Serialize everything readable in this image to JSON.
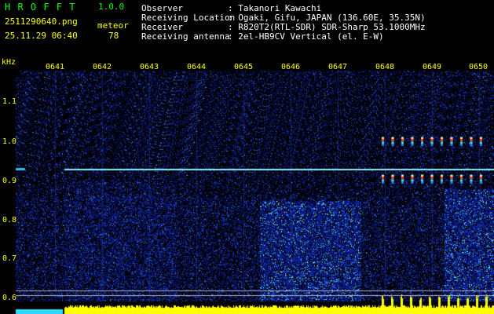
{
  "header": {
    "app_title": "H R O F F T",
    "version": "1.0.0",
    "filename": "2511290640.png",
    "datetime": "25.11.29 06:40",
    "meteor_label": "meteor",
    "meteor_count": "78",
    "info_labels": [
      "Observer",
      "Receiving Location",
      "Receiver",
      "Receiving antenna"
    ],
    "info_values": [
      ": Takanori Kawachi",
      ": Ogaki, Gifu, JAPAN (136.60E, 35.35N)",
      ": R820T2(RTL-SDR) SDR-Sharp 53.1000MHz",
      ": 2el-HB9CV Vertical (el. E-W)"
    ]
  },
  "plot": {
    "unit_label": "kHz",
    "time_labels": [
      "0641",
      "0642",
      "0643",
      "0644",
      "0645",
      "0646",
      "0647",
      "0648",
      "0649",
      "0650"
    ],
    "freq_labels": [
      "1.1",
      "1.0",
      "0.9",
      "0.8",
      "0.7",
      "0.6"
    ],
    "colors": {
      "background": "#000000",
      "noise_base": "#0b1a8c",
      "carrier": "#8ef0ff",
      "amplitude_bar": "#ffff00",
      "label": "#ffff00",
      "hot": "#ff3030"
    }
  }
}
